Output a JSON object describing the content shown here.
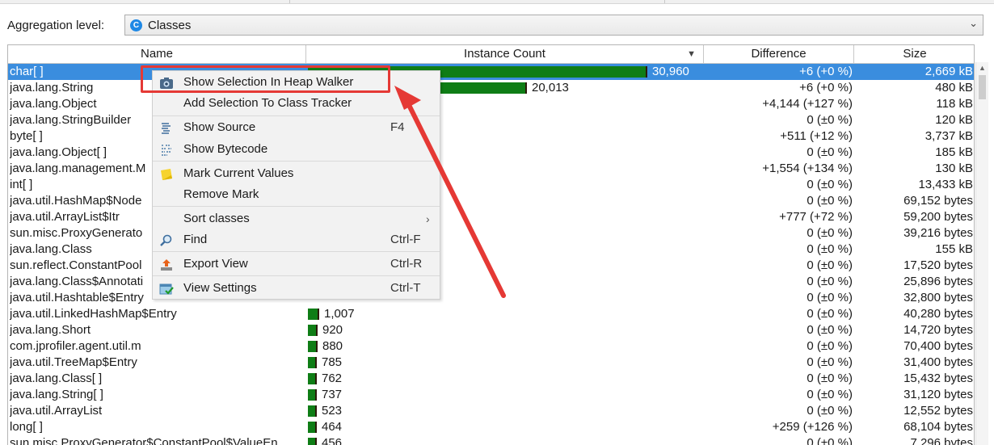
{
  "aggregation": {
    "label": "Aggregation level:",
    "selected": "Classes",
    "icon": "class-c-icon"
  },
  "columns": {
    "name": "Name",
    "count": "Instance Count",
    "difference": "Difference",
    "size": "Size"
  },
  "chart_data": {
    "type": "bar",
    "title": "",
    "categories": [
      "char[]",
      "java.lang.String",
      "java.lang.Object",
      "java.lang.StringBuilder",
      "byte[]",
      "java.lang.Object[]",
      "java.lang.management.M",
      "int[]",
      "java.util.HashMap$Node",
      "java.util.ArrayList$Itr",
      "sun.misc.ProxyGenerato",
      "java.lang.Class",
      "sun.reflect.ConstantPool",
      "java.lang.Class$Annotati",
      "java.util.Hashtable$Entry",
      "java.util.LinkedHashMap$Entry",
      "java.lang.Short",
      "com.jprofiler.agent.util.m",
      "java.util.TreeMap$Entry",
      "java.lang.Class[]",
      "java.lang.String[]",
      "java.util.ArrayList",
      "long[]",
      "sun.misc.ProxyGenerator$ConstantPool$ValueEn..."
    ],
    "values": [
      30960,
      20013,
      null,
      null,
      null,
      null,
      null,
      null,
      null,
      null,
      null,
      null,
      null,
      null,
      null,
      1007,
      920,
      880,
      785,
      762,
      737,
      523,
      464,
      456
    ],
    "xlabel": "",
    "ylabel": "Instance Count"
  },
  "rows": [
    {
      "name": "char[ ]",
      "count": "30,960",
      "diff": "+6 (+0 %)",
      "size": "2,669 kB",
      "selected": true
    },
    {
      "name": "java.lang.String",
      "count": "20,013",
      "diff": "+6 (+0 %)",
      "size": "480 kB"
    },
    {
      "name": "java.lang.Object",
      "count": "",
      "diff": "+4,144 (+127 %)",
      "size": "118 kB"
    },
    {
      "name": "java.lang.StringBuilder",
      "count": "",
      "diff": "0 (±0 %)",
      "size": "120 kB"
    },
    {
      "name": "byte[ ]",
      "count": "",
      "diff": "+511 (+12 %)",
      "size": "3,737 kB"
    },
    {
      "name": "java.lang.Object[ ]",
      "count": "",
      "diff": "0 (±0 %)",
      "size": "185 kB"
    },
    {
      "name": "java.lang.management.M",
      "count": "",
      "diff": "+1,554 (+134 %)",
      "size": "130 kB"
    },
    {
      "name": "int[ ]",
      "count": "",
      "diff": "0 (±0 %)",
      "size": "13,433 kB"
    },
    {
      "name": "java.util.HashMap$Node",
      "count": "",
      "diff": "0 (±0 %)",
      "size": "69,152 bytes"
    },
    {
      "name": "java.util.ArrayList$Itr",
      "count": "",
      "diff": "+777 (+72 %)",
      "size": "59,200 bytes"
    },
    {
      "name": "sun.misc.ProxyGenerato",
      "count": "",
      "diff": "0 (±0 %)",
      "size": "39,216 bytes"
    },
    {
      "name": "java.lang.Class",
      "count": "",
      "diff": "0 (±0 %)",
      "size": "155 kB"
    },
    {
      "name": "sun.reflect.ConstantPool",
      "count": "",
      "diff": "0 (±0 %)",
      "size": "17,520 bytes"
    },
    {
      "name": "java.lang.Class$Annotati",
      "count": "",
      "diff": "0 (±0 %)",
      "size": "25,896 bytes"
    },
    {
      "name": "java.util.Hashtable$Entry",
      "count": "",
      "diff": "0 (±0 %)",
      "size": "32,800 bytes"
    },
    {
      "name": "java.util.LinkedHashMap$Entry",
      "count": "1,007",
      "diff": "0 (±0 %)",
      "size": "40,280 bytes"
    },
    {
      "name": "java.lang.Short",
      "count": "920",
      "diff": "0 (±0 %)",
      "size": "14,720 bytes"
    },
    {
      "name": "com.jprofiler.agent.util.m",
      "count": "880",
      "diff": "0 (±0 %)",
      "size": "70,400 bytes"
    },
    {
      "name": "java.util.TreeMap$Entry",
      "count": "785",
      "diff": "0 (±0 %)",
      "size": "31,400 bytes"
    },
    {
      "name": "java.lang.Class[ ]",
      "count": "762",
      "diff": "0 (±0 %)",
      "size": "15,432 bytes"
    },
    {
      "name": "java.lang.String[ ]",
      "count": "737",
      "diff": "0 (±0 %)",
      "size": "31,120 bytes"
    },
    {
      "name": "java.util.ArrayList",
      "count": "523",
      "diff": "0 (±0 %)",
      "size": "12,552 bytes"
    },
    {
      "name": "long[ ]",
      "count": "464",
      "diff": "+259 (+126 %)",
      "size": "68,104 bytes"
    },
    {
      "name": "sun.misc.ProxyGenerator$ConstantPool$ValueEn...",
      "count": "456",
      "diff": "0 (±0 %)",
      "size": "7,296 bytes"
    }
  ],
  "context_menu": {
    "items": [
      {
        "label": "Show Selection In Heap Walker",
        "shortcut": "",
        "icon": "camera-icon"
      },
      {
        "label": "Add Selection To Class Tracker",
        "shortcut": "",
        "icon": ""
      },
      {
        "label": "Show Source",
        "shortcut": "F4",
        "icon": "source-icon"
      },
      {
        "label": "Show Bytecode",
        "shortcut": "",
        "icon": "bytecode-icon"
      },
      {
        "label": "Mark Current Values",
        "shortcut": "",
        "icon": "sticky-note-icon"
      },
      {
        "label": "Remove Mark",
        "shortcut": "",
        "icon": ""
      },
      {
        "label": "Sort classes",
        "shortcut": "",
        "icon": "",
        "submenu": true
      },
      {
        "label": "Find",
        "shortcut": "Ctrl-F",
        "icon": "search-icon"
      },
      {
        "label": "Export View",
        "shortcut": "Ctrl-R",
        "icon": "export-icon"
      },
      {
        "label": "View Settings",
        "shortcut": "Ctrl-T",
        "icon": "settings-icon"
      }
    ]
  },
  "colors": {
    "selection": "#3a8dde",
    "bar": "#0f7d16",
    "annotation": "#e53935",
    "menu_bg": "#f2f2f2"
  }
}
